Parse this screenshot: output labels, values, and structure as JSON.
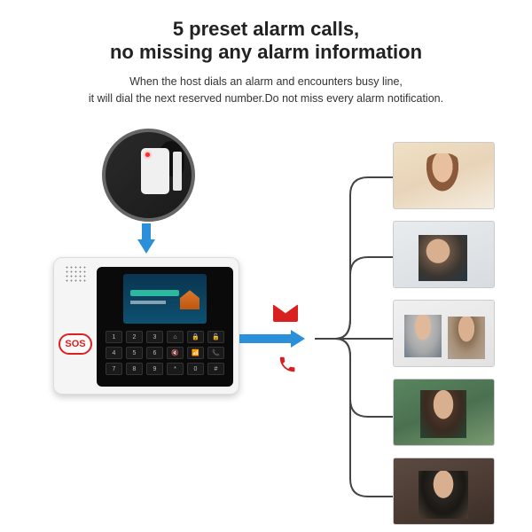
{
  "header": {
    "title_line1": "5 preset alarm calls,",
    "title_line2": "no missing any alarm information",
    "subtitle_line1": "When the host dials an alarm and encounters busy line,",
    "subtitle_line2": "it will dial the next reserved number.Do not miss every alarm notification."
  },
  "device": {
    "sos_label": "SOS",
    "keys": [
      "1",
      "2",
      "3",
      "⌂",
      "🔒",
      "🔓",
      "4",
      "5",
      "6",
      "🔇",
      "📶",
      "📞",
      "7",
      "8",
      "9",
      "*",
      "0",
      "#"
    ]
  },
  "icons": {
    "sensor": "door-sensor-icon",
    "arrow_down": "arrow-down-icon",
    "arrow_right": "arrow-right-icon",
    "mail": "mail-icon",
    "phone": "phone-icon"
  },
  "contacts": [
    {
      "desc": "woman-surprised-phone"
    },
    {
      "desc": "man-thinking-phone"
    },
    {
      "desc": "elderly-couple-phone"
    },
    {
      "desc": "man-outdoor-phone"
    },
    {
      "desc": "woman-brown-bg-phone"
    }
  ],
  "colors": {
    "arrow_blue": "#2b8fd9",
    "alert_red": "#d92020",
    "connector": "#444444"
  }
}
